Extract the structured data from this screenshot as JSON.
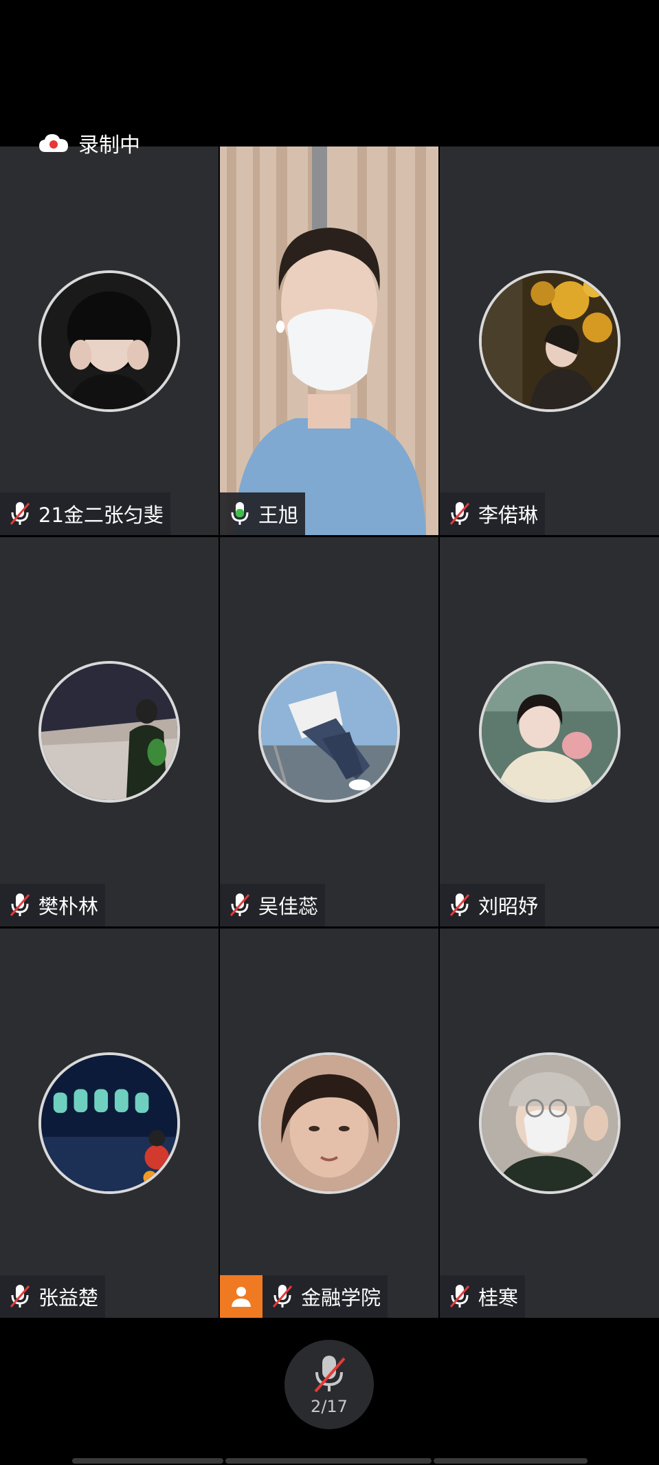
{
  "recording": {
    "label": "录制中",
    "icon": "cloud-record-icon"
  },
  "participants": [
    {
      "name": "21金二张匀斐",
      "mic": "muted"
    },
    {
      "name": "王旭",
      "mic": "active",
      "video": true
    },
    {
      "name": "李偌琳",
      "mic": "muted"
    },
    {
      "name": "樊朴林",
      "mic": "muted"
    },
    {
      "name": "吴佳蕊",
      "mic": "muted"
    },
    {
      "name": "刘昭妤",
      "mic": "muted"
    },
    {
      "name": "张益楚",
      "mic": "muted"
    },
    {
      "name": "金融学院",
      "mic": "muted",
      "host": true
    },
    {
      "name": "桂寒",
      "mic": "muted"
    }
  ],
  "bottom": {
    "mic_count": "2/17",
    "mic_state": "muted"
  },
  "colors": {
    "tile_bg": "#2c2d31",
    "host_badge": "#f07a22",
    "mic_active": "#3cc04a",
    "mic_muted_slash": "#e23b3b"
  }
}
